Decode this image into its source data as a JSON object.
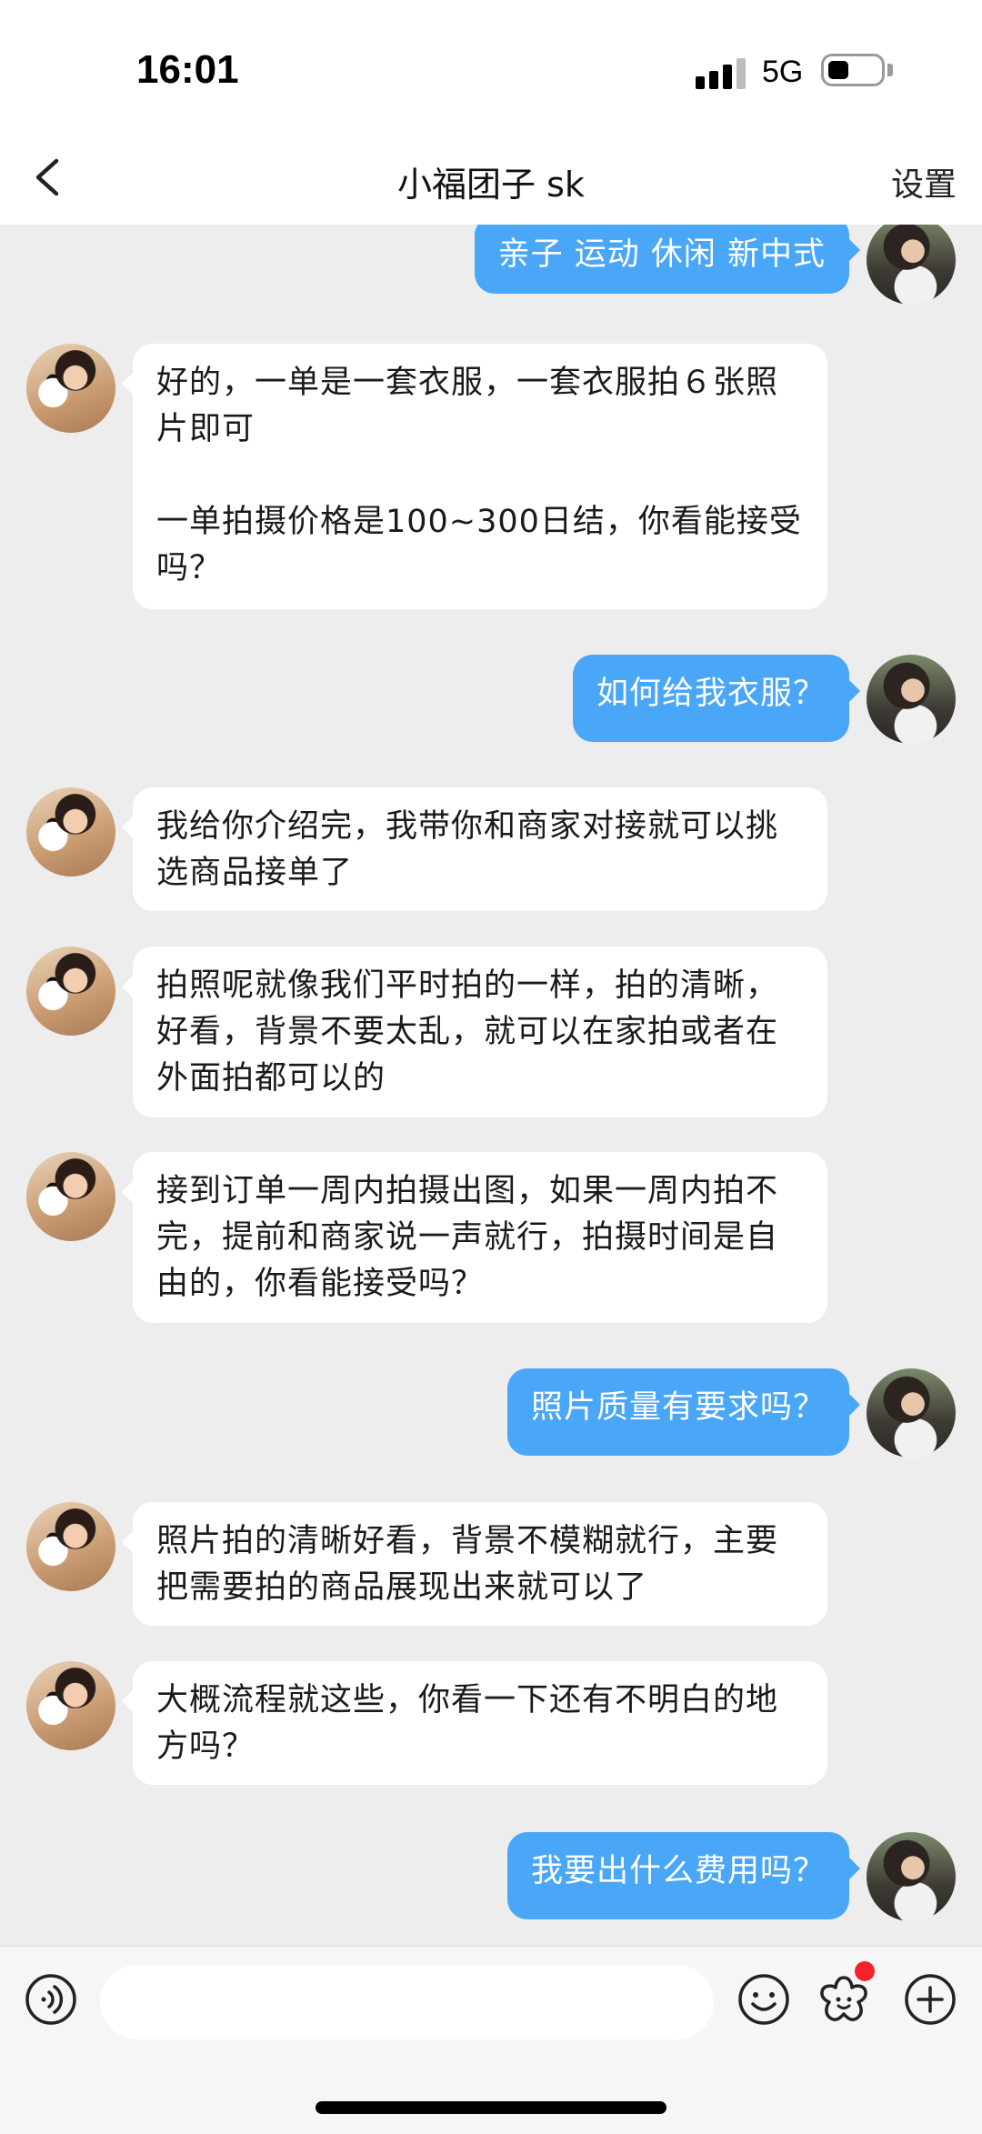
{
  "status_bar": {
    "time": "16:01",
    "network": "5G"
  },
  "nav": {
    "title": "小福团子 sk",
    "settings_label": "设置",
    "back_icon": "chevron-left-icon"
  },
  "messages": [
    {
      "sender": "self",
      "text": "亲子 运动 休闲 新中式"
    },
    {
      "sender": "other",
      "text": "好的，一单是一套衣服，一套衣服拍６张照片即可\n\n一单拍摄价格是100~300日结，你看能接受吗？"
    },
    {
      "sender": "self",
      "text": "如何给我衣服？"
    },
    {
      "sender": "other",
      "text": "我给你介绍完，我带你和商家对接就可以挑选商品接单了"
    },
    {
      "sender": "other",
      "text": "拍照呢就像我们平时拍的一样，拍的清晰，好看，背景不要太乱，就可以在家拍或者在外面拍都可以的"
    },
    {
      "sender": "other",
      "text": "接到订单一周内拍摄出图，如果一周内拍不完，提前和商家说一声就行，拍摄时间是自由的，你看能接受吗？"
    },
    {
      "sender": "self",
      "text": "照片质量有要求吗？"
    },
    {
      "sender": "other",
      "text": "照片拍的清晰好看，背景不模糊就行，主要把需要拍的商品展现出来就可以了"
    },
    {
      "sender": "other",
      "text": "大概流程就这些，你看一下还有不明白的地方吗？"
    },
    {
      "sender": "self",
      "text": "我要出什么费用吗？"
    }
  ],
  "input_bar": {
    "text_value": "",
    "icons": [
      "voice-icon",
      "emoji-icon",
      "flower-icon",
      "plus-icon"
    ]
  },
  "colors": {
    "self_bubble": "#4aa6f6",
    "other_bubble": "#ffffff",
    "chat_background": "#ededed",
    "badge": "#f5222d"
  }
}
